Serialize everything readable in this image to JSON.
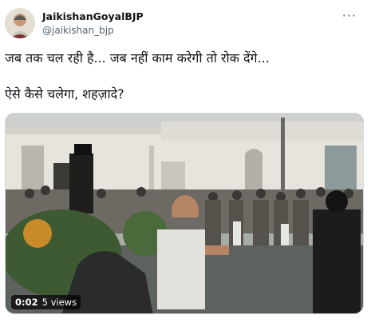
{
  "tweet": {
    "author_name": "JaikishanGoyalBJP",
    "author_handle": "@jaikishan_bjp",
    "more_icon": "more-options-icon",
    "text_line1": "जब तक चल रही है... जब नहीं काम करेगी तो रोक देंगे...",
    "text_line2": "ऐसे कैसे चलेगा, शहज़ादे?"
  },
  "video": {
    "duration": "0:02",
    "views": "5 views"
  }
}
